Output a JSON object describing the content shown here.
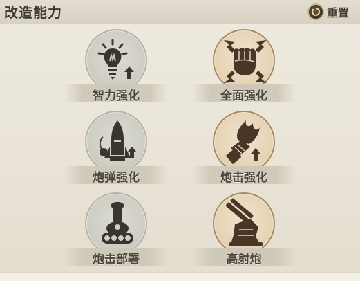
{
  "header": {
    "title": "改造能力",
    "reset_label": "重置"
  },
  "skills": [
    {
      "label": "智力强化",
      "icon": "lightbulb-upgrade-icon",
      "state": "locked"
    },
    {
      "label": "全面强化",
      "icon": "fist-arrows-icon",
      "state": "active"
    },
    {
      "label": "炮弹强化",
      "icon": "shell-upgrade-icon",
      "state": "locked"
    },
    {
      "label": "炮击强化",
      "icon": "fire-fist-upgrade-icon",
      "state": "active"
    },
    {
      "label": "炮击部署",
      "icon": "cannon-deploy-icon",
      "state": "locked"
    },
    {
      "label": "高射炮",
      "icon": "anti-air-gun-icon",
      "state": "active"
    }
  ],
  "colors": {
    "locked": "#cfcec5",
    "active": "#e6d4b6",
    "icon_dark": "#3a352e",
    "icon_brown": "#4a3526"
  }
}
